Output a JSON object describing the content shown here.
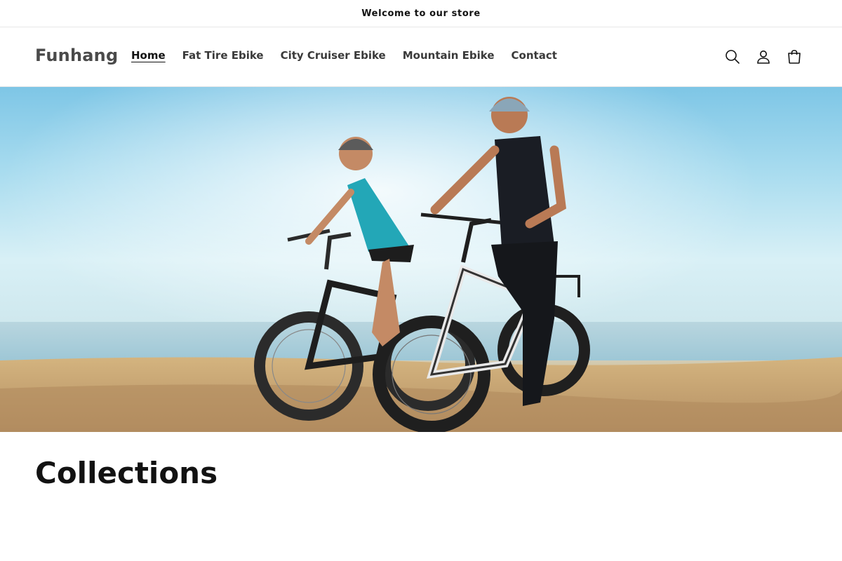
{
  "announcement": {
    "text": "Welcome to our store"
  },
  "header": {
    "logo": "Funhang",
    "nav": [
      {
        "label": "Home",
        "active": true
      },
      {
        "label": "Fat Tire Ebike",
        "active": false
      },
      {
        "label": "City Cruiser Ebike",
        "active": false
      },
      {
        "label": "Mountain Ebike",
        "active": false
      },
      {
        "label": "Contact",
        "active": false
      }
    ],
    "icons": [
      "search-icon",
      "account-icon",
      "cart-icon"
    ]
  },
  "hero": {
    "image": "two-riders-on-fat-tire-ebikes-by-the-sea"
  },
  "collections": {
    "title": "Collections"
  },
  "colors": {
    "text": "#121212",
    "logo": "#4a4a4a",
    "border": "#e7e7e7"
  }
}
